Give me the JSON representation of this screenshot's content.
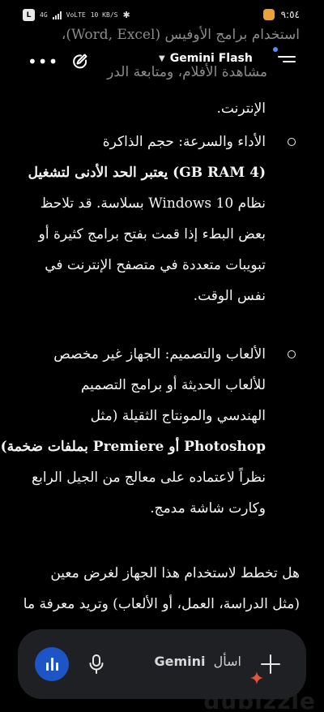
{
  "status_bar": {
    "sim_badge": "L",
    "network_type": "4G",
    "volte_label": "VoLTE",
    "data_speed": "10 KB/S",
    "time": "٩:٥٤",
    "battery_color": "#e8a23a"
  },
  "header": {
    "model_name": "Gemini Flash",
    "more_icon": "more-horizontal-icon",
    "edit_icon": "edit-pen-icon",
    "menu_icon": "menu-lines-icon",
    "dot_color": "#4f8ff7"
  },
  "content": {
    "ghost_lines": [
      "استخدام برامج الأوفيس (Word, Excel)،",
      "مشاهدة الأفلام، ومتابعة الدر"
    ],
    "continued_line": "الإنترنت.",
    "items": [
      {
        "lead": "الأداء والسرعة:",
        "lines": [
          "الأداء والسرعة: حجم الذاكرة",
          "(4 GB RAM) يعتبر الحد الأدنى لتشغيل",
          "نظام Windows 10 بسلاسة. قد تلاحظ",
          "بعض البطء إذا قمت بفتح برامج كثيرة أو",
          "تبويبات متعددة في متصفح الإنترنت في",
          "نفس الوقت."
        ]
      },
      {
        "lead": "الألعاب والتصميم:",
        "lines": [
          "الألعاب والتصميم: الجهاز غير مخصص",
          "للألعاب الحديثة أو برامج التصميم",
          "الهندسي والمونتاج الثقيلة (مثل",
          "Photoshop أو Premiere بملفات ضخمة)،",
          "نظراً لاعتماده على معالج من الجيل الرابع",
          "وكارت شاشة مدمج."
        ]
      }
    ],
    "question_lines": [
      "هل تخطط لاستخدام هذا الجهاز لغرض معين",
      "(مثل الدراسة، العمل، أو الألعاب) وتريد معرفة ما"
    ]
  },
  "input_bar": {
    "placeholder_prefix": "اسأل",
    "placeholder_brand": "Gemini",
    "live_button_icon": "live-waveform-icon",
    "mic_icon": "microphone-icon",
    "add_icon": "plus-icon",
    "live_button_color": "#1d55c6"
  },
  "watermark": "dubizzle"
}
